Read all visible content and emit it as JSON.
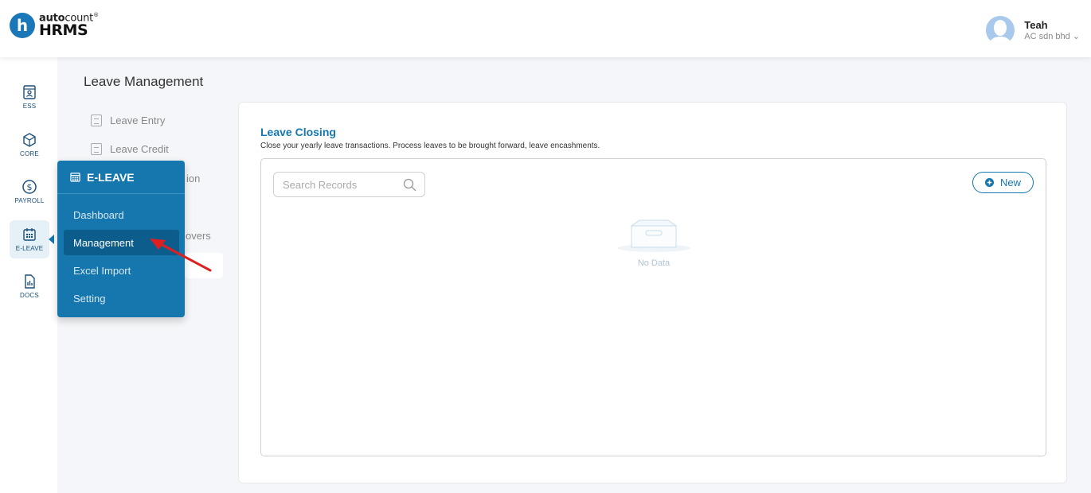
{
  "header": {
    "logo_letter": "h",
    "logo_top_bold": "auto",
    "logo_top_regular": "count",
    "logo_mark": "®",
    "logo_bottom": "HRMS",
    "user_name": "Teah",
    "user_company": "AC sdn bhd ⌄"
  },
  "rail": {
    "items": [
      {
        "label": "ESS",
        "icon": "ess-icon"
      },
      {
        "label": "CORE",
        "icon": "cube-icon"
      },
      {
        "label": "PAYROLL",
        "icon": "dollar-icon"
      },
      {
        "label": "E-LEAVE",
        "icon": "calendar-icon"
      },
      {
        "label": "DOCS",
        "icon": "docs-icon"
      }
    ]
  },
  "subnav": {
    "title": "Leave Management",
    "items": [
      {
        "label": "Leave Entry"
      },
      {
        "label": "Leave Credit"
      },
      {
        "label": "ion"
      },
      {
        "label": "overs"
      }
    ]
  },
  "flyout": {
    "title": "E-LEAVE",
    "items": [
      {
        "label": "Dashboard"
      },
      {
        "label": "Management"
      },
      {
        "label": "Excel Import"
      },
      {
        "label": "Setting"
      }
    ]
  },
  "main": {
    "title": "Leave Closing",
    "description": "Close your yearly leave transactions. Process leaves to be brought forward, leave encashments.",
    "search_placeholder": "Search Records",
    "new_button": "New",
    "empty_text": "No Data"
  },
  "colors": {
    "primary": "#1577ad",
    "primary_dark": "#0d5d8c",
    "annotation_arrow": "#e02020"
  }
}
